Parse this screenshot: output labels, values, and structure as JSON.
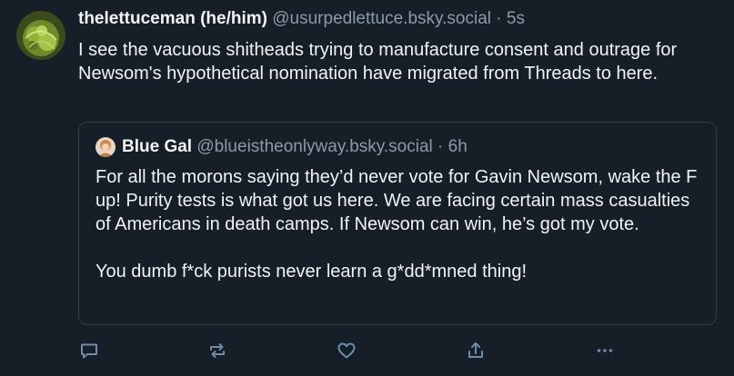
{
  "post": {
    "display_name": "thelettuceman (he/him)",
    "handle": "@usurpedlettuce.bsky.social",
    "separator": "·",
    "time": "5s",
    "avatar_text": "lettuce",
    "text": "I see the vacuous shitheads trying to manufacture consent and outrage for Newsom's hypothetical nomination have migrated from Threads to here."
  },
  "quote": {
    "display_name": "Blue Gal",
    "handle": "@blueistheonlyway.bsky.social",
    "separator": "·",
    "time": "6h",
    "paragraphs": [
      "For all the morons saying they’d never vote for Gavin Newsom, wake the F up! Purity tests is what got us here. We are facing certain mass casualties of Americans in death camps. If Newsom can win, he’s got my vote.",
      "You dumb f*ck purists never learn a g*dd*mned thing!"
    ]
  },
  "actions": {
    "icons": [
      "reply-icon",
      "repost-icon",
      "like-icon",
      "share-icon",
      "more-icon"
    ]
  },
  "colors": {
    "background": "#161e27",
    "text": "#f1f3f5",
    "muted": "#8c9aa8",
    "border": "#2e3b48",
    "icon": "#6f8cab"
  }
}
